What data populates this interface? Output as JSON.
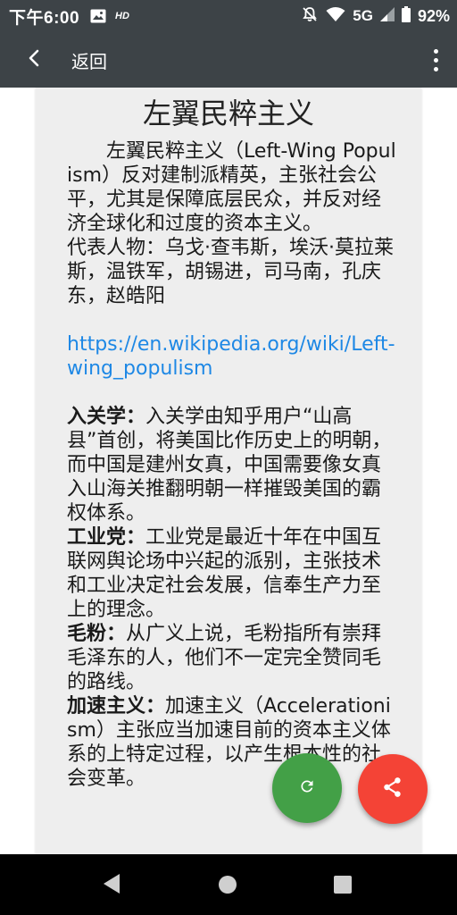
{
  "status_bar": {
    "time": "下午6:00",
    "hd_label": "HD",
    "network": "5G",
    "battery": "92%",
    "icons": [
      "image-icon",
      "mute-icon",
      "wifi-icon",
      "signal-icon",
      "battery-icon"
    ]
  },
  "app_bar": {
    "back_label": "返回",
    "icons": [
      "back-arrow-icon",
      "more-vert-icon"
    ]
  },
  "article": {
    "title": "左翼民粹主义",
    "intro": "左翼民粹主义（Left-Wing Populism）反对建制派精英，主张社会公平，尤其是保障底层民众，并反对经济全球化和过度的资本主义。",
    "representatives": "代表人物：乌戈·查韦斯，埃沃·莫拉莱斯，温铁军，胡锡进，司马南，孔庆东，赵皓阳",
    "link": "https://en.wikipedia.org/wiki/Left-wing_populism",
    "terms": [
      {
        "term": "入关学",
        "sep": "：",
        "desc": "入关学由知乎用户“山高县”首创，将美国比作历史上的明朝，而中国是建州女真，中国需要像女真入山海关推翻明朝一样摧毁美国的霸权体系。"
      },
      {
        "term": "工业党",
        "sep": "：",
        "desc": "工业党是最近十年在中国互联网舆论场中兴起的派别，主张技术和工业决定社会发展，信奉生产力至上的理念。"
      },
      {
        "term": "毛粉",
        "sep": "：",
        "desc": "从广义上说，毛粉指所有崇拜毛泽东的人，他们不一定完全赞同毛的路线。"
      },
      {
        "term": "加速主义",
        "sep": "：",
        "desc": "加速主义（Accelerationism）主张应当加速目前的资本主义体系的上特定过程，以产生根本性的社会变革。"
      }
    ]
  },
  "fabs": {
    "refresh_icon": "refresh-icon",
    "share_icon": "share-icon",
    "refresh_color": "#43a047",
    "share_color": "#f44336"
  },
  "nav_bar": {
    "icons": [
      "nav-back-icon",
      "nav-home-icon",
      "nav-recents-icon"
    ]
  },
  "colors": {
    "bar": "#3d4347",
    "card": "#eeeeee",
    "link": "#1e88e5"
  }
}
